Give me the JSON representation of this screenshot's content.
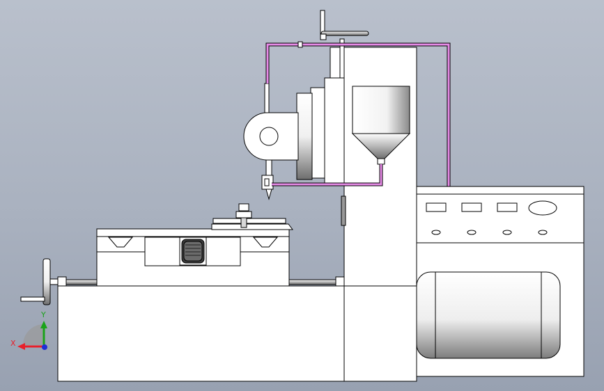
{
  "view": {
    "background_top": "#b9c0cc",
    "background_bottom": "#98a1b1",
    "line_color": "#000000",
    "pipe_color": "#e68ae6"
  },
  "triad": {
    "x_label": "X",
    "y_label": "Y",
    "x_color": "#e8202a",
    "y_color": "#1aa31a",
    "z_color": "#1f2fd6"
  }
}
